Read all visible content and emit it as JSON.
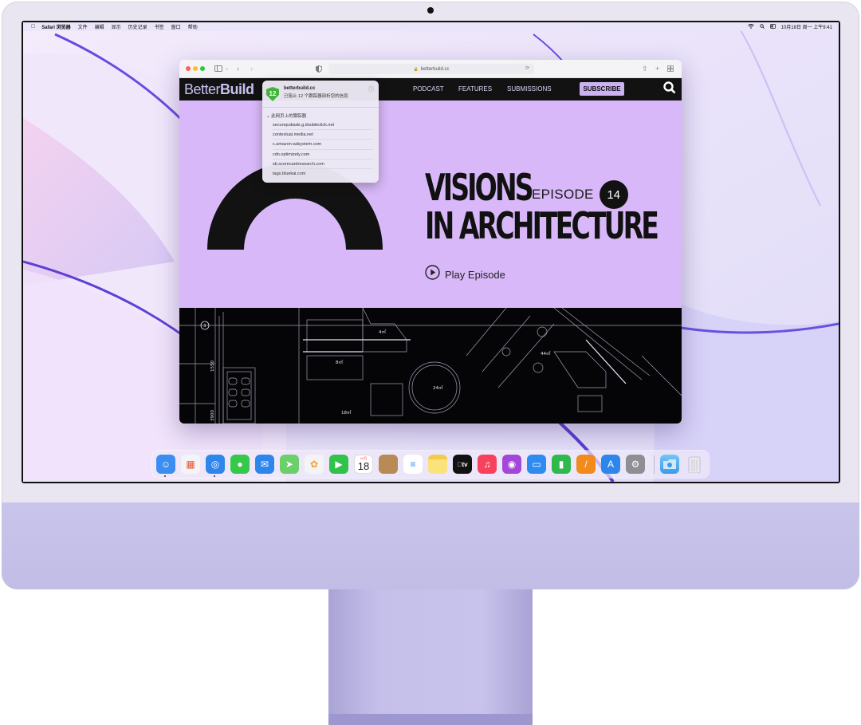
{
  "menubar": {
    "items": [
      "Safari 浏览器",
      "文件",
      "编辑",
      "显示",
      "历史记录",
      "书签",
      "窗口",
      "帮助"
    ],
    "clock": "10月18日 周一 上午9:41"
  },
  "safari": {
    "address": "betterbuild.cc"
  },
  "site": {
    "logo_light": "Better",
    "logo_bold": "Build",
    "nav": [
      "PODCAST",
      "FEATURES",
      "SUBMISSIONS"
    ],
    "subscribe": "SUBSCRIBE",
    "hero": {
      "title_line1": "VISIONS",
      "title_line2": "IN ARCHITECTURE",
      "episode_label": "EPISODE",
      "episode_number": "14",
      "play_label": "Play Episode"
    },
    "blueprint_labels": [
      "4㎡",
      "8㎡",
      "24㎡",
      "44㎡",
      "18㎡",
      "1550",
      "3900",
      "3"
    ]
  },
  "privacy_report": {
    "tracker_count": "12",
    "site": "betterbuild.cc",
    "description": "已阻止 12 个跟踪器剖析您的信息",
    "section_title": "此网页上的跟踪器",
    "trackers": [
      "securepubads.g.doubleclick.net",
      "contextual.media.net",
      "c.amazon-adsystem.com",
      "cdn.optimizely.com",
      "sb.scorecardresearch.com",
      "tags.bluekai.com"
    ]
  },
  "dock": {
    "apps": [
      {
        "name": "finder-icon",
        "color": "#3b8ef0"
      },
      {
        "name": "launchpad-icon",
        "color": "#f4f4f6"
      },
      {
        "name": "safari-icon",
        "color": "#2f86ea"
      },
      {
        "name": "messages-icon",
        "color": "#36c84a"
      },
      {
        "name": "mail-icon",
        "color": "#2f86ea"
      },
      {
        "name": "maps-icon",
        "color": "#6ccf6a"
      },
      {
        "name": "photos-icon",
        "color": "#f4f4f6"
      },
      {
        "name": "facetime-icon",
        "color": "#30c24a"
      },
      {
        "name": "calendar-icon",
        "color": "#ffffff"
      },
      {
        "name": "contacts-icon",
        "color": "#b88a55"
      },
      {
        "name": "reminders-icon",
        "color": "#ffffff"
      },
      {
        "name": "notes-icon",
        "color": "#fbe27a"
      },
      {
        "name": "tv-icon",
        "color": "#111111"
      },
      {
        "name": "music-icon",
        "color": "#f8425d"
      },
      {
        "name": "podcasts-icon",
        "color": "#a247d8"
      },
      {
        "name": "keynote-icon",
        "color": "#2e8bf0"
      },
      {
        "name": "numbers-icon",
        "color": "#2fb94d"
      },
      {
        "name": "pages-icon",
        "color": "#f28a1e"
      },
      {
        "name": "app-store-icon",
        "color": "#2f86ea"
      },
      {
        "name": "system-preferences-icon",
        "color": "#8e8e93"
      }
    ],
    "calendar_month": "10月",
    "calendar_day": "18",
    "tv_label": "tv"
  }
}
